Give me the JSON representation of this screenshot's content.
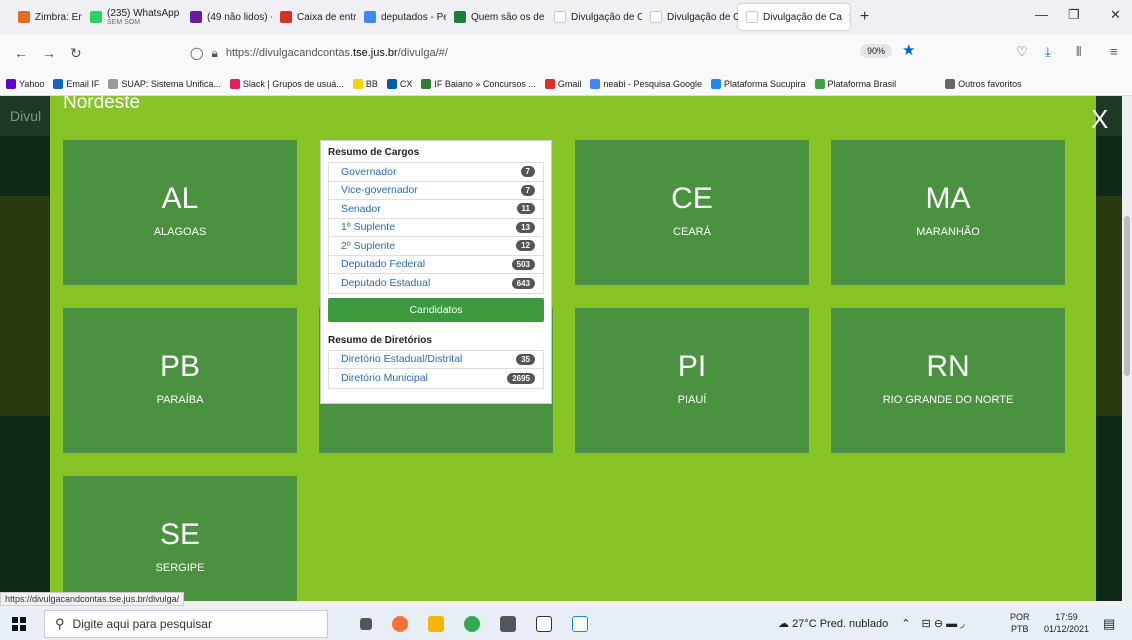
{
  "tabs": [
    {
      "label": "Zimbra: Entrada",
      "color": "#e56b1f"
    },
    {
      "label": "(235) WhatsApp",
      "sub": "SEM SOM",
      "color": "#25d366"
    },
    {
      "label": "(49 não lidos) -",
      "color": "#6a1b9a"
    },
    {
      "label": "Caixa de entrad",
      "color": "#d93025"
    },
    {
      "label": "deputados - Pes",
      "color": "#4285f4"
    },
    {
      "label": "Quem são os de",
      "color": "#1a7f37"
    },
    {
      "label": "Divulgação de Cand",
      "color": "#ffffff"
    },
    {
      "label": "Divulgação de Cand",
      "color": "#ffffff"
    },
    {
      "label": "Divulgação de Ca",
      "color": "#ffffff",
      "active": true
    }
  ],
  "navbar": {
    "url_prefix": "https://divulgacandcontas.",
    "url_domain": "tse.jus.br",
    "url_suffix": "/divulga/#/",
    "zoom": "90%"
  },
  "bookmarks": [
    {
      "label": "Yahoo",
      "color": "#5f01d1"
    },
    {
      "label": "Email IF",
      "color": "#1565c0"
    },
    {
      "label": "SUAP: Sistema Unifica...",
      "color": "#999999"
    },
    {
      "label": "Slack | Grupos de usuá...",
      "color": "#e01e5a"
    },
    {
      "label": "BB",
      "color": "#f7d117"
    },
    {
      "label": "CX",
      "color": "#005ca9"
    },
    {
      "label": "IF Baiano » Concursos ...",
      "color": "#2e7d32"
    },
    {
      "label": "Gmail",
      "color": "#d93025"
    },
    {
      "label": "neabi - Pesquisa Google",
      "color": "#4285f4"
    },
    {
      "label": "Plataforma Sucupira",
      "color": "#1e88e5"
    },
    {
      "label": "Plataforma Brasil",
      "color": "#43a047"
    },
    {
      "label": "Outros favoritos",
      "color": "#666666"
    }
  ],
  "page": {
    "behind_title": "Divul",
    "region_title": "Nordeste",
    "close_label": "X"
  },
  "states": [
    {
      "abbr": "AL",
      "name": "ALAGOAS"
    },
    {
      "abbr": "CE",
      "name": "CEARÁ"
    },
    {
      "abbr": "MA",
      "name": "MARANHÃO"
    },
    {
      "abbr": "PB",
      "name": "PARAÍBA"
    },
    {
      "abbr": "PI",
      "name": "PIAUÍ"
    },
    {
      "abbr": "RN",
      "name": "RIO GRANDE DO NORTE"
    },
    {
      "abbr": "SE",
      "name": "SERGIPE"
    }
  ],
  "popup": {
    "cargos_title": "Resumo de Cargos",
    "cargos": [
      {
        "label": "Governador",
        "count": "7"
      },
      {
        "label": "Vice-governador",
        "count": "7"
      },
      {
        "label": "Senador",
        "count": "11"
      },
      {
        "label": "1º Suplente",
        "count": "13"
      },
      {
        "label": "2º Suplente",
        "count": "12"
      },
      {
        "label": "Deputado Federal",
        "count": "503"
      },
      {
        "label": "Deputado Estadual",
        "count": "643"
      }
    ],
    "button_label": "Candidatos",
    "diretorios_title": "Resumo de Diretórios",
    "diretorios": [
      {
        "label": "Diretório Estadual/Distrital",
        "count": "35"
      },
      {
        "label": "Diretório Municipal",
        "count": "2695"
      }
    ]
  },
  "status_url": "https://divulgacandcontas.tse.jus.br/divulga/",
  "taskbar": {
    "search_placeholder": "Digite aqui para pesquisar",
    "weather": "27°C  Pred. nublado",
    "lang1": "POR",
    "lang2": "PTB",
    "time": "17:59",
    "date": "01/12/2021"
  }
}
